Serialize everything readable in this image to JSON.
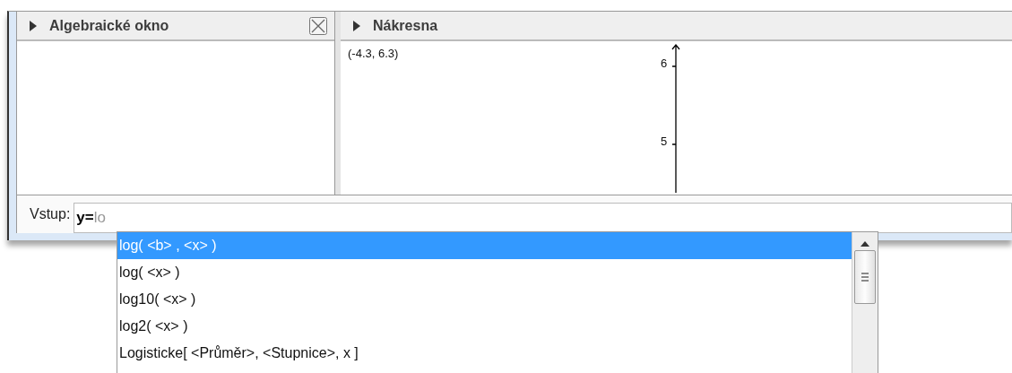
{
  "algebra_panel": {
    "title": "Algebraické okno"
  },
  "graphics_panel": {
    "title": "Nákresna",
    "coordinates": "(-4.3, 6.3)",
    "y_ticks": [
      "6",
      "5"
    ]
  },
  "input_bar": {
    "label": "Vstup:",
    "value": "**y=**lo"
  },
  "suggestions": [
    {
      "text": "log( <b> , <x> )",
      "selected": true
    },
    {
      "text": "log( <x> )",
      "selected": false
    },
    {
      "text": "log10( <x> )",
      "selected": false
    },
    {
      "text": "log2( <x> )",
      "selected": false
    },
    {
      "text": "Logisticke[ <Průměr>, <Stupnice>, x ]",
      "selected": false
    }
  ]
}
